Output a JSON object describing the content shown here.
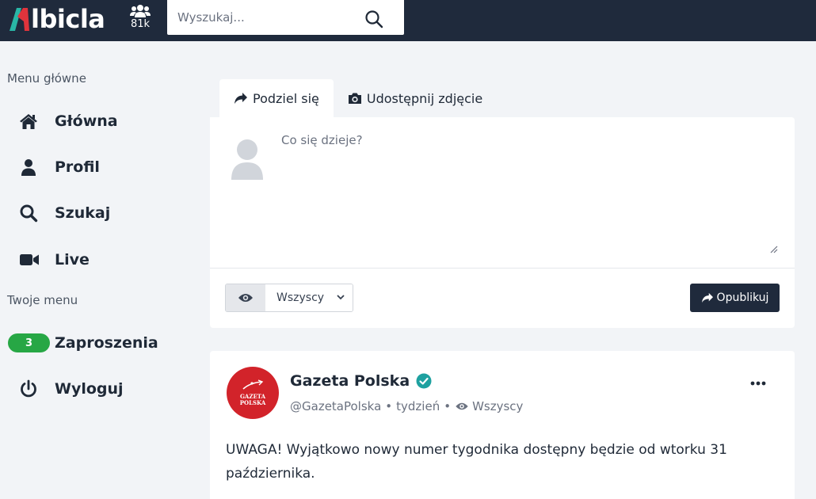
{
  "header": {
    "logo_text": "lbicla",
    "members_count": "81k",
    "search_placeholder": "Wyszukaj..."
  },
  "sidebar": {
    "main_menu_label": "Menu główne",
    "main_items": [
      {
        "label": "Główna",
        "icon": "home-icon"
      },
      {
        "label": "Profil",
        "icon": "user-icon"
      },
      {
        "label": "Szukaj",
        "icon": "search-icon"
      },
      {
        "label": "Live",
        "icon": "video-camera-icon"
      }
    ],
    "your_menu_label": "Twoje menu",
    "your_items": [
      {
        "label": "Zaproszenia",
        "badge": "3"
      },
      {
        "label": "Wyloguj",
        "icon": "power-icon"
      }
    ]
  },
  "composer": {
    "tabs": [
      {
        "label": "Podziel się",
        "icon": "share-icon",
        "active": true
      },
      {
        "label": "Udostępnij zdjęcie",
        "icon": "camera-icon",
        "active": false
      }
    ],
    "placeholder": "Co się dzieje?",
    "visibility_value": "Wszyscy",
    "publish_label": "Opublikuj"
  },
  "post": {
    "author": "Gazeta Polska",
    "avatar_text": "GAZETA POLSKA",
    "handle": "@GazetaPolska",
    "time": "tydzień",
    "visibility": "Wszyscy",
    "text": "UWAGA! Wyjątkowo nowy numer tygodnika dostępny będzie od wtorku 31 października."
  },
  "colors": {
    "header_bg": "#1f2a3c",
    "page_bg": "#f2f4f7",
    "badge_green": "#27a745",
    "verified_teal": "#1ea1a0",
    "brand_red": "#d2232a",
    "logo_teal": "#29b6a6",
    "logo_red": "#e0343c"
  }
}
